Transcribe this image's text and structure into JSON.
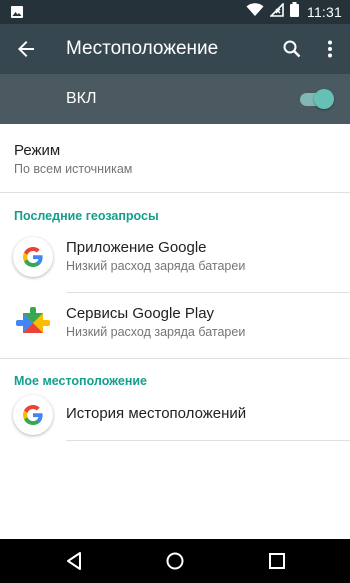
{
  "status_bar": {
    "time": "11:31",
    "icons": [
      "image-notification-icon",
      "wifi-icon",
      "signal-off-icon",
      "battery-icon"
    ]
  },
  "toolbar": {
    "title": "Местоположение",
    "back_icon": "arrow-back-icon",
    "search_icon": "search-icon",
    "more_icon": "more-vert-icon"
  },
  "master_switch": {
    "label": "ВКЛ",
    "checked": true,
    "accent": "#65c1b6"
  },
  "mode": {
    "title": "Режим",
    "subtitle": "По всем источникам"
  },
  "recent_requests": {
    "header": "Последние геозапросы",
    "items": [
      {
        "title": "Приложение Google",
        "subtitle": "Низкий расход заряда батареи",
        "icon": "google-g-icon"
      },
      {
        "title": "Сервисы Google Play",
        "subtitle": "Низкий расход заряда батареи",
        "icon": "google-play-services-icon"
      }
    ]
  },
  "my_location": {
    "header": "Мое местоположение",
    "items": [
      {
        "title": "История местоположений",
        "icon": "google-g-icon"
      }
    ]
  },
  "colors": {
    "status_bar": "#25323a",
    "toolbar": "#37474f",
    "switch_bar": "#4b5a61",
    "section_header": "#139f8c"
  },
  "nav_bar": {
    "icons": [
      "nav-back-icon",
      "nav-home-icon",
      "nav-recents-icon"
    ]
  }
}
